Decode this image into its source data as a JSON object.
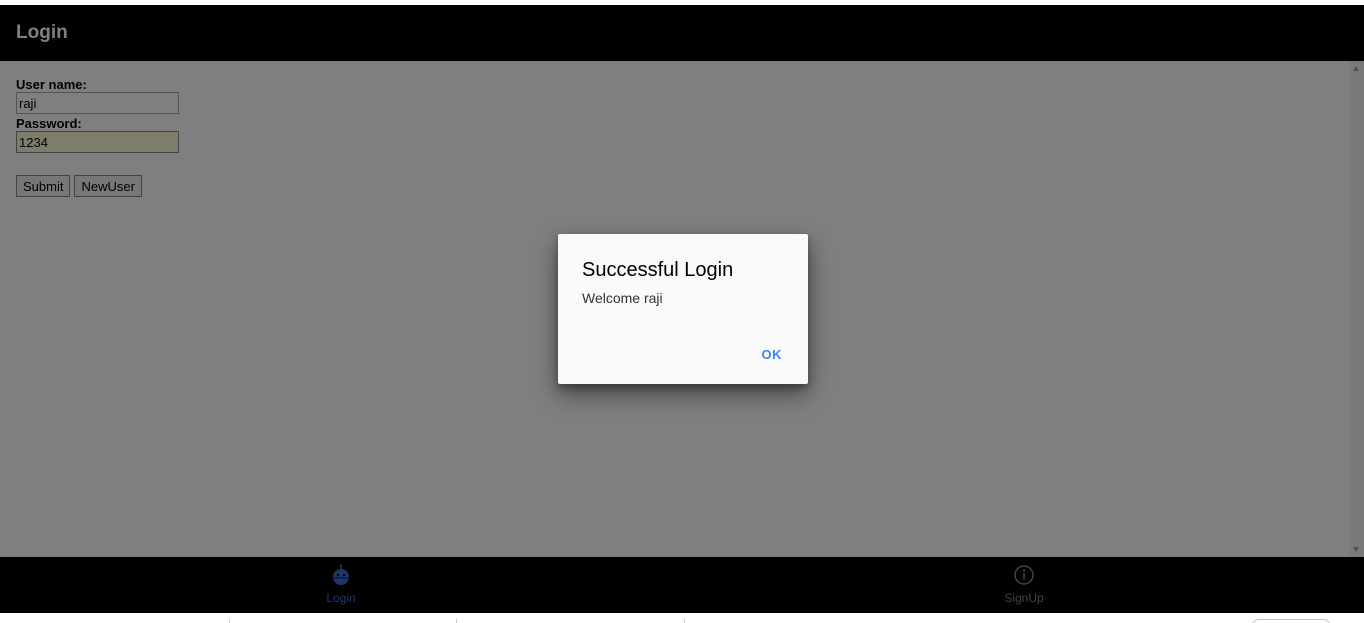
{
  "header": {
    "title": "Login"
  },
  "form": {
    "username_label": "User name:",
    "username_value": "raji",
    "password_label": "Password:",
    "password_value": "1234",
    "submit_label": "Submit",
    "newuser_label": "NewUser"
  },
  "tabs": [
    {
      "label": "Login",
      "icon": "robot-icon",
      "active": true,
      "color": "#3a6fd8"
    },
    {
      "label": "SignUp",
      "icon": "info-circle-icon",
      "active": false,
      "color": "#888888"
    }
  ],
  "dialog": {
    "title": "Successful Login",
    "message": "Welcome raji",
    "ok_label": "OK",
    "ok_color": "#3a86ff"
  },
  "colors": {
    "header_bg": "#000000",
    "tabbar_bg": "#000000",
    "autofill_bg": "#fafad2"
  }
}
